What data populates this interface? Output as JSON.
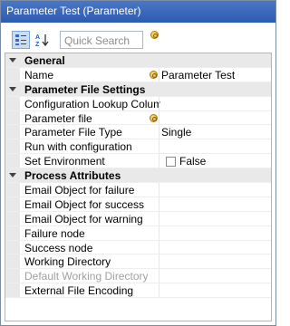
{
  "window": {
    "title": "Parameter Test (Parameter)"
  },
  "toolbar": {
    "categorized_icon": "categorized-view-icon",
    "alphabetical_icon": "alphabetical-sort-icon",
    "search_placeholder": "Quick Search",
    "search_option_icon": "parameter-icon"
  },
  "grid": {
    "general": {
      "title": "General",
      "name_label": "Name",
      "name_value": "Parameter Test"
    },
    "param_file": {
      "title": "Parameter File Settings",
      "config_lookup_label": "Configuration Lookup Column",
      "param_file_label": "Parameter file",
      "param_file_type_label": "Parameter File Type",
      "param_file_type_value": "Single",
      "run_with_config_label": "Run with configuration",
      "set_env_label": "Set Environment",
      "set_env_value": "False"
    },
    "process": {
      "title": "Process Attributes",
      "email_failure_label": "Email Object for failure",
      "email_success_label": "Email Object for success",
      "email_warning_label": "Email Object for warning",
      "failure_node_label": "Failure node",
      "success_node_label": "Success node",
      "working_dir_label": "Working Directory",
      "default_working_dir_label": "Default Working Directory",
      "ext_file_encoding_label": "External File Encoding"
    }
  }
}
